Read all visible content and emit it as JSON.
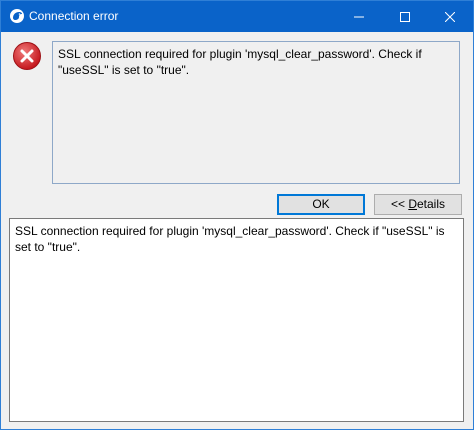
{
  "window": {
    "title": "Connection error",
    "app_icon": "dolphin-logo-icon",
    "controls": {
      "minimize": "minimize-icon",
      "maximize": "maximize-icon",
      "close": "close-icon"
    }
  },
  "dialog": {
    "icon": "error-icon",
    "message": "SSL connection required for plugin 'mysql_clear_password'. Check if \"useSSL\" is set to \"true\".",
    "buttons": {
      "ok_label": "OK",
      "details_prefix": "<< ",
      "details_mnemonic": "D",
      "details_rest": "etails"
    },
    "details_text": "SSL connection required for plugin 'mysql_clear_password'. Check if \"useSSL\" is set to \"true\"."
  },
  "colors": {
    "titlebar": "#0a63c9",
    "error_red": "#d6282e",
    "focus_border": "#0078d7"
  }
}
